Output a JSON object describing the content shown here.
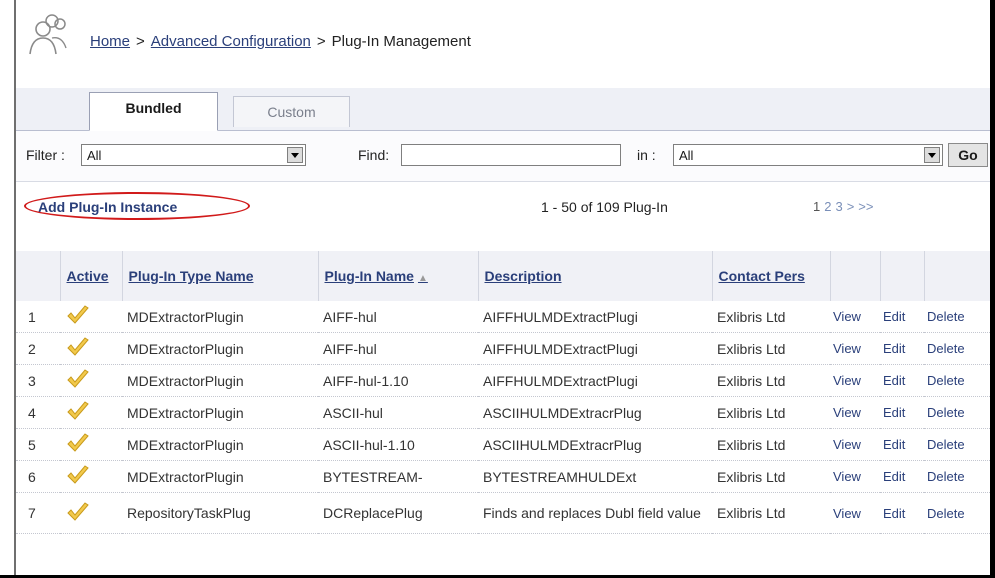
{
  "breadcrumb": {
    "home": "Home",
    "sep1": ">",
    "advanced": "Advanced Configuration",
    "sep2": ">",
    "current": "Plug-In Management"
  },
  "tabs": [
    {
      "label": "Bundled",
      "active": true
    },
    {
      "label": "Custom",
      "active": false
    }
  ],
  "filter": {
    "filter_label": "Filter :",
    "filter_value": "All",
    "find_label": "Find:",
    "find_value": "",
    "in_label": "in :",
    "in_value": "All",
    "go_label": "Go"
  },
  "actions": {
    "add_label": "Add Plug-In Instance",
    "count_text": "1 - 50 of 109 Plug-In",
    "pages": [
      "1",
      "2",
      "3",
      ">",
      ">>"
    ]
  },
  "table": {
    "columns": [
      "",
      "Active",
      "Plug-In Type Name",
      "Plug-In Name",
      "Description",
      "Contact Pers",
      "",
      "",
      ""
    ],
    "rows": [
      {
        "num": "1",
        "type": "MDExtractorPlugin",
        "name": "AIFF-hul",
        "desc": "AIFFHULMDExtractPlugi",
        "contact": "Exlibris Ltd",
        "view": "View",
        "edit": "Edit",
        "delete": "Delete"
      },
      {
        "num": "2",
        "type": "MDExtractorPlugin",
        "name": "AIFF-hul",
        "desc": "AIFFHULMDExtractPlugi",
        "contact": "Exlibris Ltd",
        "view": "View",
        "edit": "Edit",
        "delete": "Delete"
      },
      {
        "num": "3",
        "type": "MDExtractorPlugin",
        "name": "AIFF-hul-1.10",
        "desc": "AIFFHULMDExtractPlugi",
        "contact": "Exlibris Ltd",
        "view": "View",
        "edit": "Edit",
        "delete": "Delete"
      },
      {
        "num": "4",
        "type": "MDExtractorPlugin",
        "name": "ASCII-hul",
        "desc": "ASCIIHULMDExtracrPlug",
        "contact": "Exlibris Ltd",
        "view": "View",
        "edit": "Edit",
        "delete": "Delete"
      },
      {
        "num": "5",
        "type": "MDExtractorPlugin",
        "name": "ASCII-hul-1.10",
        "desc": "ASCIIHULMDExtracrPlug",
        "contact": "Exlibris Ltd",
        "view": "View",
        "edit": "Edit",
        "delete": "Delete"
      },
      {
        "num": "6",
        "type": "MDExtractorPlugin",
        "name": "BYTESTREAM-",
        "desc": "BYTESTREAMHULDExt",
        "contact": "Exlibris Ltd",
        "view": "View",
        "edit": "Edit",
        "delete": "Delete"
      },
      {
        "num": "7",
        "type": "RepositoryTaskPlug",
        "name": "DCReplacePlug",
        "desc": "Finds and replaces Dubl field value",
        "contact": "Exlibris Ltd",
        "view": "View",
        "edit": "Edit",
        "delete": "Delete"
      }
    ]
  },
  "colors": {
    "link": "#2a3f7a",
    "highlight_oval": "#d11a1a",
    "check_yellow": "#f2c94c"
  },
  "icons": [
    "users-icon",
    "check-icon",
    "dropdown-arrow-icon",
    "sort-asc-icon"
  ]
}
